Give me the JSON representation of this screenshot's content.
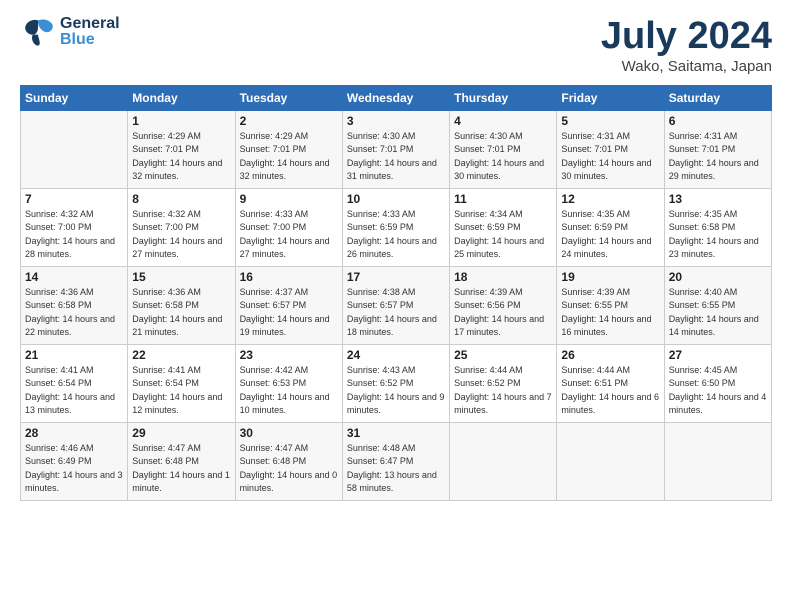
{
  "header": {
    "logo_general": "General",
    "logo_blue": "Blue",
    "title": "July 2024",
    "subtitle": "Wako, Saitama, Japan"
  },
  "weekdays": [
    "Sunday",
    "Monday",
    "Tuesday",
    "Wednesday",
    "Thursday",
    "Friday",
    "Saturday"
  ],
  "weeks": [
    [
      {
        "day": "",
        "sunrise": "",
        "sunset": "",
        "daylight": ""
      },
      {
        "day": "1",
        "sunrise": "Sunrise: 4:29 AM",
        "sunset": "Sunset: 7:01 PM",
        "daylight": "Daylight: 14 hours and 32 minutes."
      },
      {
        "day": "2",
        "sunrise": "Sunrise: 4:29 AM",
        "sunset": "Sunset: 7:01 PM",
        "daylight": "Daylight: 14 hours and 32 minutes."
      },
      {
        "day": "3",
        "sunrise": "Sunrise: 4:30 AM",
        "sunset": "Sunset: 7:01 PM",
        "daylight": "Daylight: 14 hours and 31 minutes."
      },
      {
        "day": "4",
        "sunrise": "Sunrise: 4:30 AM",
        "sunset": "Sunset: 7:01 PM",
        "daylight": "Daylight: 14 hours and 30 minutes."
      },
      {
        "day": "5",
        "sunrise": "Sunrise: 4:31 AM",
        "sunset": "Sunset: 7:01 PM",
        "daylight": "Daylight: 14 hours and 30 minutes."
      },
      {
        "day": "6",
        "sunrise": "Sunrise: 4:31 AM",
        "sunset": "Sunset: 7:01 PM",
        "daylight": "Daylight: 14 hours and 29 minutes."
      }
    ],
    [
      {
        "day": "7",
        "sunrise": "Sunrise: 4:32 AM",
        "sunset": "Sunset: 7:00 PM",
        "daylight": "Daylight: 14 hours and 28 minutes."
      },
      {
        "day": "8",
        "sunrise": "Sunrise: 4:32 AM",
        "sunset": "Sunset: 7:00 PM",
        "daylight": "Daylight: 14 hours and 27 minutes."
      },
      {
        "day": "9",
        "sunrise": "Sunrise: 4:33 AM",
        "sunset": "Sunset: 7:00 PM",
        "daylight": "Daylight: 14 hours and 27 minutes."
      },
      {
        "day": "10",
        "sunrise": "Sunrise: 4:33 AM",
        "sunset": "Sunset: 6:59 PM",
        "daylight": "Daylight: 14 hours and 26 minutes."
      },
      {
        "day": "11",
        "sunrise": "Sunrise: 4:34 AM",
        "sunset": "Sunset: 6:59 PM",
        "daylight": "Daylight: 14 hours and 25 minutes."
      },
      {
        "day": "12",
        "sunrise": "Sunrise: 4:35 AM",
        "sunset": "Sunset: 6:59 PM",
        "daylight": "Daylight: 14 hours and 24 minutes."
      },
      {
        "day": "13",
        "sunrise": "Sunrise: 4:35 AM",
        "sunset": "Sunset: 6:58 PM",
        "daylight": "Daylight: 14 hours and 23 minutes."
      }
    ],
    [
      {
        "day": "14",
        "sunrise": "Sunrise: 4:36 AM",
        "sunset": "Sunset: 6:58 PM",
        "daylight": "Daylight: 14 hours and 22 minutes."
      },
      {
        "day": "15",
        "sunrise": "Sunrise: 4:36 AM",
        "sunset": "Sunset: 6:58 PM",
        "daylight": "Daylight: 14 hours and 21 minutes."
      },
      {
        "day": "16",
        "sunrise": "Sunrise: 4:37 AM",
        "sunset": "Sunset: 6:57 PM",
        "daylight": "Daylight: 14 hours and 19 minutes."
      },
      {
        "day": "17",
        "sunrise": "Sunrise: 4:38 AM",
        "sunset": "Sunset: 6:57 PM",
        "daylight": "Daylight: 14 hours and 18 minutes."
      },
      {
        "day": "18",
        "sunrise": "Sunrise: 4:39 AM",
        "sunset": "Sunset: 6:56 PM",
        "daylight": "Daylight: 14 hours and 17 minutes."
      },
      {
        "day": "19",
        "sunrise": "Sunrise: 4:39 AM",
        "sunset": "Sunset: 6:55 PM",
        "daylight": "Daylight: 14 hours and 16 minutes."
      },
      {
        "day": "20",
        "sunrise": "Sunrise: 4:40 AM",
        "sunset": "Sunset: 6:55 PM",
        "daylight": "Daylight: 14 hours and 14 minutes."
      }
    ],
    [
      {
        "day": "21",
        "sunrise": "Sunrise: 4:41 AM",
        "sunset": "Sunset: 6:54 PM",
        "daylight": "Daylight: 14 hours and 13 minutes."
      },
      {
        "day": "22",
        "sunrise": "Sunrise: 4:41 AM",
        "sunset": "Sunset: 6:54 PM",
        "daylight": "Daylight: 14 hours and 12 minutes."
      },
      {
        "day": "23",
        "sunrise": "Sunrise: 4:42 AM",
        "sunset": "Sunset: 6:53 PM",
        "daylight": "Daylight: 14 hours and 10 minutes."
      },
      {
        "day": "24",
        "sunrise": "Sunrise: 4:43 AM",
        "sunset": "Sunset: 6:52 PM",
        "daylight": "Daylight: 14 hours and 9 minutes."
      },
      {
        "day": "25",
        "sunrise": "Sunrise: 4:44 AM",
        "sunset": "Sunset: 6:52 PM",
        "daylight": "Daylight: 14 hours and 7 minutes."
      },
      {
        "day": "26",
        "sunrise": "Sunrise: 4:44 AM",
        "sunset": "Sunset: 6:51 PM",
        "daylight": "Daylight: 14 hours and 6 minutes."
      },
      {
        "day": "27",
        "sunrise": "Sunrise: 4:45 AM",
        "sunset": "Sunset: 6:50 PM",
        "daylight": "Daylight: 14 hours and 4 minutes."
      }
    ],
    [
      {
        "day": "28",
        "sunrise": "Sunrise: 4:46 AM",
        "sunset": "Sunset: 6:49 PM",
        "daylight": "Daylight: 14 hours and 3 minutes."
      },
      {
        "day": "29",
        "sunrise": "Sunrise: 4:47 AM",
        "sunset": "Sunset: 6:48 PM",
        "daylight": "Daylight: 14 hours and 1 minute."
      },
      {
        "day": "30",
        "sunrise": "Sunrise: 4:47 AM",
        "sunset": "Sunset: 6:48 PM",
        "daylight": "Daylight: 14 hours and 0 minutes."
      },
      {
        "day": "31",
        "sunrise": "Sunrise: 4:48 AM",
        "sunset": "Sunset: 6:47 PM",
        "daylight": "Daylight: 13 hours and 58 minutes."
      },
      {
        "day": "",
        "sunrise": "",
        "sunset": "",
        "daylight": ""
      },
      {
        "day": "",
        "sunrise": "",
        "sunset": "",
        "daylight": ""
      },
      {
        "day": "",
        "sunrise": "",
        "sunset": "",
        "daylight": ""
      }
    ]
  ]
}
